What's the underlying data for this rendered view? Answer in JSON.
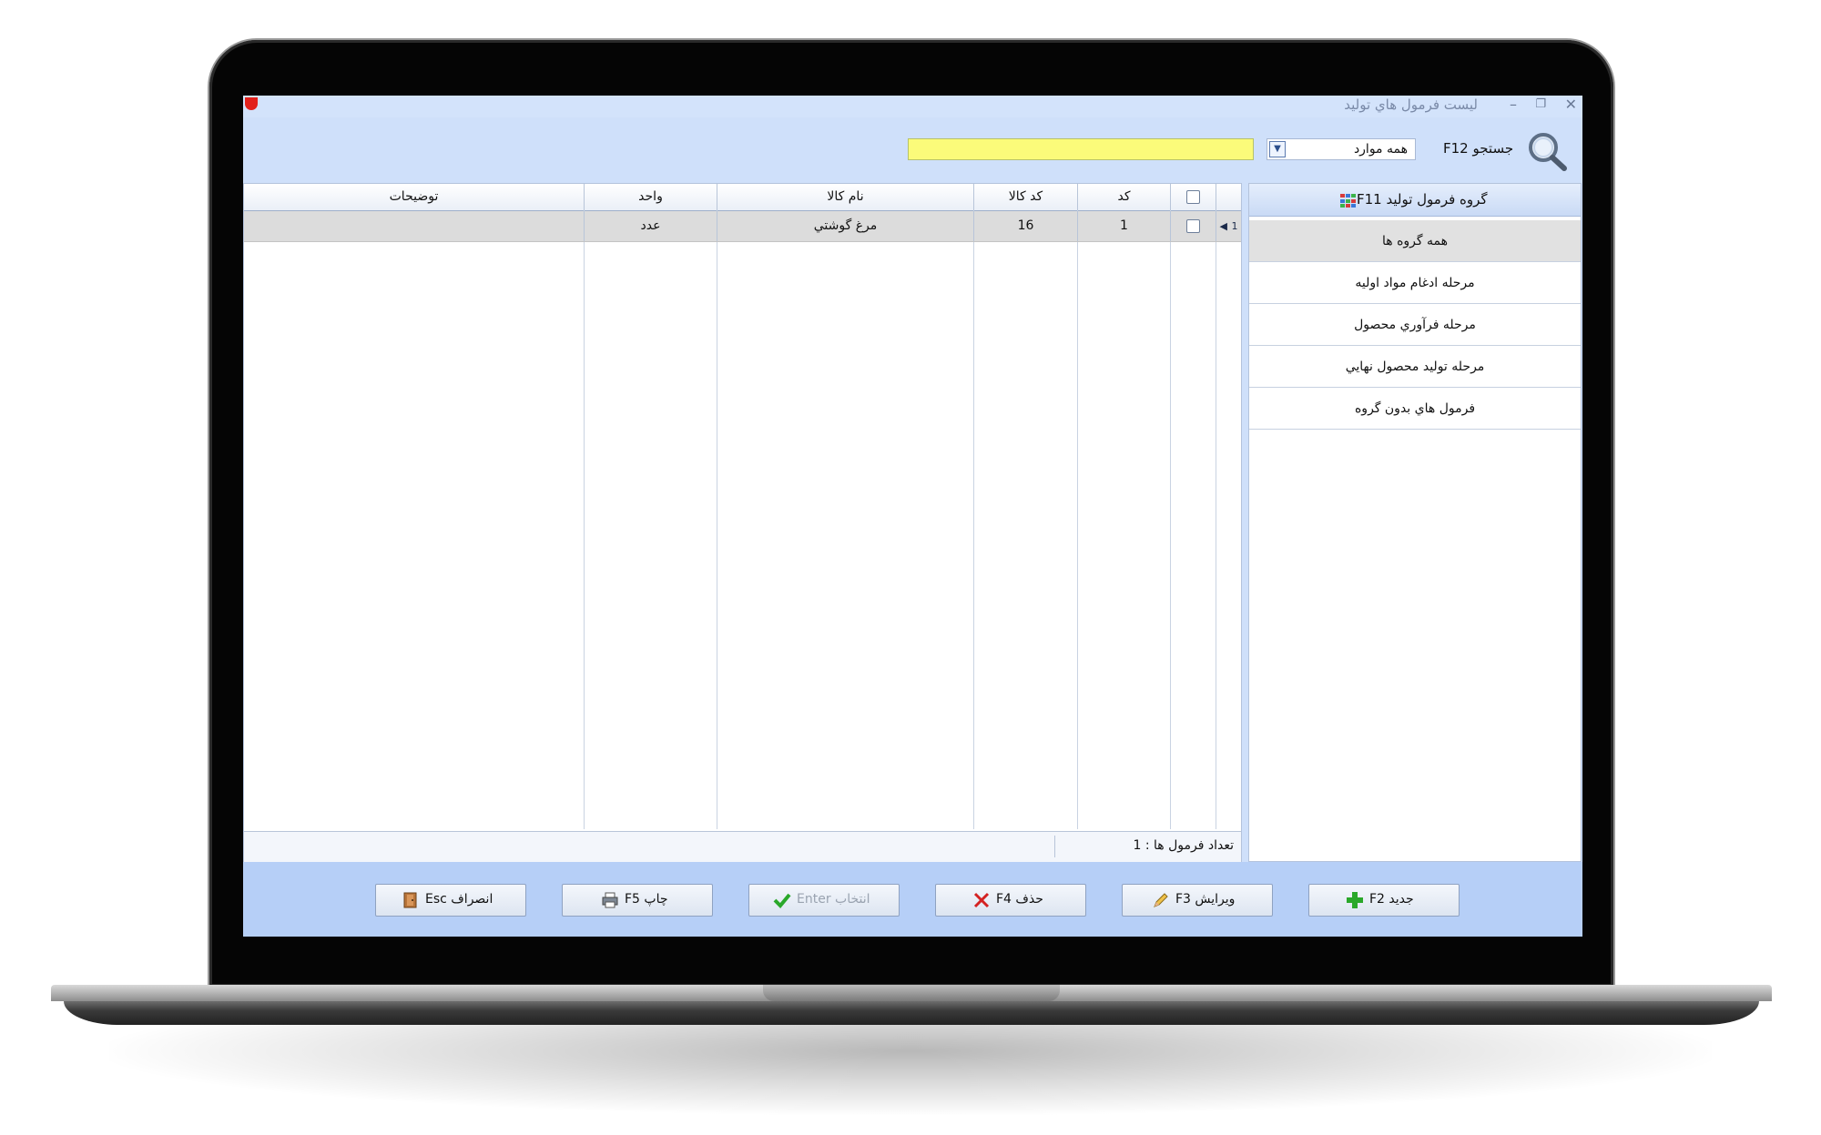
{
  "window": {
    "title": "ليست فرمول هاي توليد",
    "min_glyph": "–",
    "max_glyph": "❐",
    "close_glyph": "✕"
  },
  "search": {
    "label": "جستجو F12",
    "scope_value": "همه موارد",
    "query": "",
    "icon": "search-icon"
  },
  "table": {
    "columns": [
      "",
      "",
      "كد",
      "كد كالا",
      "نام كالا",
      "واحد",
      "توضيحات"
    ],
    "rows": [
      {
        "indicator": "1",
        "checked": false,
        "code": "1",
        "item_code": "16",
        "item_name": "مرغ گوشتي",
        "unit": "عدد",
        "description": ""
      }
    ],
    "footer_count": "تعداد فرمول ها : 1"
  },
  "groups": {
    "header_label": "گروه فرمول توليد F11",
    "items": [
      {
        "label": "همه گروه ها",
        "active": true
      },
      {
        "label": "مرحله ادغام مواد اوليه",
        "active": false
      },
      {
        "label": "مرحله فرآوري محصول",
        "active": false
      },
      {
        "label": "مرحله توليد محصول نهايي",
        "active": false
      },
      {
        "label": "فرمول هاي بدون گروه",
        "active": false
      }
    ]
  },
  "actions": {
    "new": "جديد F2",
    "edit": "ويرايش F3",
    "delete": "حذف F4",
    "select": "انتخاب Enter",
    "print": "چاپ F5",
    "cancel": "انصراف Esc"
  },
  "colors": {
    "window_bg": "#cfe0fa",
    "action_bar": "#b6cff7",
    "search_highlight": "#fbfb7a",
    "selected_row": "#dcdcdc"
  }
}
